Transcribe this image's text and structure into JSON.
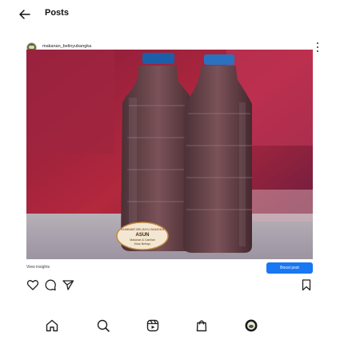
{
  "header": {
    "title": "Posts",
    "back_icon": "arrow-left-icon"
  },
  "post": {
    "username": "makanan_belinyubangka",
    "photo_label": {
      "line1": "GUMMAR BELINYU BANGKA",
      "line2": "ASUN",
      "line3": "Makanan & Camilan",
      "line4": "Khas Belinyu"
    }
  },
  "insights": {
    "label": "View insights"
  },
  "boost": {
    "label": "Boost post"
  },
  "actions": [
    "heart-icon",
    "comment-icon",
    "share-icon",
    "bookmark-icon"
  ],
  "nav": [
    "home-icon",
    "search-icon",
    "reels-icon",
    "shop-icon",
    "profile-icon"
  ],
  "colors": {
    "accent": "#1877f2",
    "boost_text": "#ffffff"
  }
}
